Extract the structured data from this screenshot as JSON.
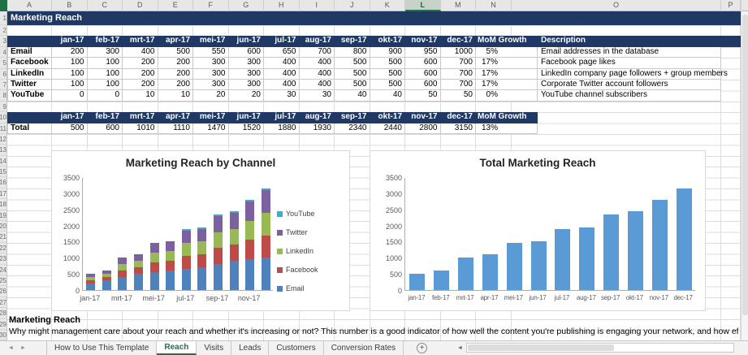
{
  "sheet_title": "Marketing Reach",
  "grid": {
    "column_letters": [
      "A",
      "B",
      "C",
      "D",
      "E",
      "F",
      "G",
      "H",
      "I",
      "J",
      "K",
      "L",
      "M",
      "N",
      "O",
      "P"
    ],
    "selected_column": "L",
    "visible_row_count": 30
  },
  "table": {
    "months": [
      "jan-17",
      "feb-17",
      "mrt-17",
      "apr-17",
      "mei-17",
      "jun-17",
      "jul-17",
      "aug-17",
      "sep-17",
      "okt-17",
      "nov-17",
      "dec-17"
    ],
    "mom_label": "MoM Growth",
    "desc_label": "Description",
    "rows": [
      {
        "label": "Email",
        "values": [
          200,
          300,
          400,
          500,
          550,
          600,
          650,
          700,
          800,
          900,
          950,
          1000
        ],
        "mom": "5%",
        "desc": "Email addresses in the database"
      },
      {
        "label": "Facebook",
        "values": [
          100,
          100,
          200,
          200,
          300,
          300,
          400,
          400,
          500,
          500,
          600,
          700
        ],
        "mom": "17%",
        "desc": "Facebook page likes"
      },
      {
        "label": "LinkedIn",
        "values": [
          100,
          100,
          200,
          200,
          300,
          300,
          400,
          400,
          500,
          500,
          600,
          700
        ],
        "mom": "17%",
        "desc": "LinkedIn company page followers + group members"
      },
      {
        "label": "Twitter",
        "values": [
          100,
          100,
          200,
          200,
          300,
          300,
          400,
          400,
          500,
          500,
          600,
          700
        ],
        "mom": "17%",
        "desc": "Corporate Twitter account followers"
      },
      {
        "label": "YouTube",
        "values": [
          0,
          0,
          10,
          10,
          20,
          20,
          30,
          30,
          40,
          40,
          50,
          50
        ],
        "mom": "0%",
        "desc": "YouTube channel subscribers"
      }
    ],
    "total": {
      "label": "Total",
      "values": [
        500,
        600,
        1010,
        1110,
        1470,
        1520,
        1880,
        1930,
        2340,
        2440,
        2800,
        3150
      ],
      "mom": "13%"
    }
  },
  "note": {
    "title": "Marketing Reach",
    "body": "Why might management care about your reach and whether it's increasing or not? This number is a good indicator of how well the content you're publishing is engaging your network, and how effectively"
  },
  "tabbar": {
    "tabs": [
      "How to Use This Template",
      "Reach",
      "Visits",
      "Leads",
      "Customers",
      "Conversion Rates"
    ],
    "active": "Reach",
    "add_button": "+"
  },
  "chart_data": [
    {
      "type": "bar",
      "stacked": true,
      "title": "Marketing Reach by Channel",
      "categories": [
        "jan-17",
        "feb-17",
        "mrt-17",
        "apr-17",
        "mei-17",
        "jun-17",
        "jul-17",
        "aug-17",
        "sep-17",
        "okt-17",
        "nov-17",
        "dec-17"
      ],
      "x_tick_labels_shown": [
        "jan-17",
        "mrt-17",
        "mei-17",
        "jul-17",
        "sep-17",
        "nov-17"
      ],
      "series": [
        {
          "name": "Email",
          "color": "#4F81BD",
          "values": [
            200,
            300,
            400,
            500,
            550,
            600,
            650,
            700,
            800,
            900,
            950,
            1000
          ]
        },
        {
          "name": "Facebook",
          "color": "#BE4B48",
          "values": [
            100,
            100,
            200,
            200,
            300,
            300,
            400,
            400,
            500,
            500,
            600,
            700
          ]
        },
        {
          "name": "LinkedIn",
          "color": "#98B954",
          "values": [
            100,
            100,
            200,
            200,
            300,
            300,
            400,
            400,
            500,
            500,
            600,
            700
          ]
        },
        {
          "name": "Twitter",
          "color": "#7D60A0",
          "values": [
            100,
            100,
            200,
            200,
            300,
            300,
            400,
            400,
            500,
            500,
            600,
            700
          ]
        },
        {
          "name": "YouTube",
          "color": "#46AAC5",
          "values": [
            0,
            0,
            10,
            10,
            20,
            20,
            30,
            30,
            40,
            40,
            50,
            50
          ]
        }
      ],
      "legend": {
        "position": "right",
        "order": [
          "YouTube",
          "Twitter",
          "LinkedIn",
          "Facebook",
          "Email"
        ]
      },
      "ylim": [
        0,
        3500
      ],
      "ytick_step": 500,
      "grid": false
    },
    {
      "type": "bar",
      "title": "Total Marketing Reach",
      "categories": [
        "jan-17",
        "feb-17",
        "mrt-17",
        "apr-17",
        "mei-17",
        "jun-17",
        "jul-17",
        "aug-17",
        "sep-17",
        "okt-17",
        "nov-17",
        "dec-17"
      ],
      "values": [
        500,
        600,
        1010,
        1110,
        1470,
        1520,
        1880,
        1930,
        2340,
        2440,
        2800,
        3150
      ],
      "color": "#5B9BD5",
      "ylim": [
        0,
        3500
      ],
      "ytick_step": 500,
      "grid": false
    }
  ],
  "colors": {
    "header_navy": "#1F3864",
    "accent_green": "#217346",
    "bar_email": "#4F81BD",
    "bar_facebook": "#BE4B48",
    "bar_linkedin": "#98B954",
    "bar_twitter": "#7D60A0",
    "bar_youtube": "#46AAC5",
    "bar_total": "#5B9BD5"
  }
}
